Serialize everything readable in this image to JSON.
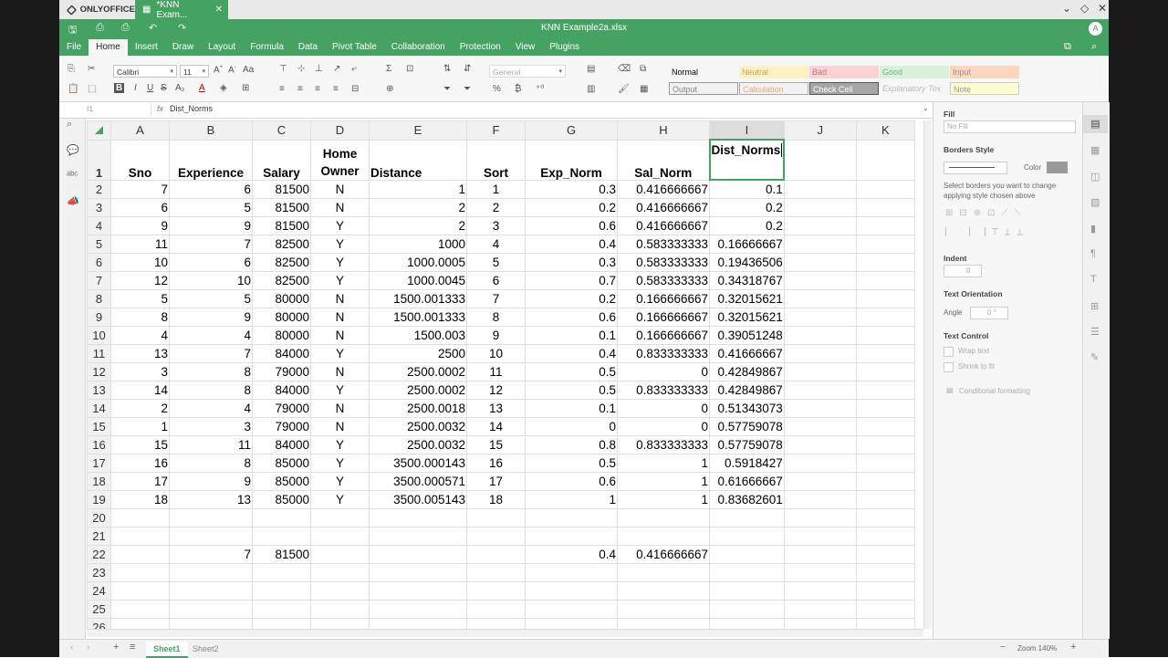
{
  "app": {
    "brand": "ONLYOFFICE",
    "tab_title": "*KNN Exam...",
    "doc_title": "KNN Example2a.xlsx",
    "user_initial": "A",
    "accent": "#44a363"
  },
  "menu": [
    "File",
    "Home",
    "Insert",
    "Draw",
    "Layout",
    "Formula",
    "Data",
    "Pivot Table",
    "Collaboration",
    "Protection",
    "View",
    "Plugins"
  ],
  "toolbar": {
    "font_name": "Calibri",
    "font_size": "11",
    "number_format": "General",
    "styles": [
      {
        "label": "Normal",
        "bg": "#ffffff",
        "color": "#555555"
      },
      {
        "label": "Neutral",
        "bg": "#fff1c4",
        "color": "#b98b2b"
      },
      {
        "label": "Bad",
        "bg": "#fbd3d7",
        "color": "#b0454d"
      },
      {
        "label": "Good",
        "bg": "#d9f1dc",
        "color": "#4a8e58"
      },
      {
        "label": "Input",
        "bg": "#fbd8bd",
        "color": "#7c6a5a"
      },
      {
        "label": "Output",
        "bg": "#f2f2f2",
        "color": "#555555"
      },
      {
        "label": "Calculation",
        "bg": "#f2f2f2",
        "color": "#e08a3c"
      },
      {
        "label": "Check Cell",
        "bg": "#a5a5a5",
        "color": "#ffffff"
      },
      {
        "label": "Explanatory Tex",
        "bg": "#ffffff",
        "color": "#888888"
      },
      {
        "label": "Note",
        "bg": "#fffdd0",
        "color": "#666666"
      }
    ]
  },
  "formula_bar": {
    "cell_ref": "I1",
    "fx": "fx",
    "content": "Dist_Norms"
  },
  "sheet": {
    "columns": [
      "A",
      "B",
      "C",
      "D",
      "E",
      "F",
      "G",
      "H",
      "I",
      "J",
      "K"
    ],
    "header": [
      "Sno",
      "Experience",
      "Salary",
      "Home\nOwner",
      "Distance",
      "Sort",
      "Exp_Norm",
      "Sal_Norm",
      "Dist_Norms",
      "",
      ""
    ],
    "rows": [
      [
        "2",
        "7",
        "6",
        "81500",
        "N",
        "1",
        "1",
        "0.3",
        "0.416666667",
        "0.1",
        "",
        ""
      ],
      [
        "3",
        "6",
        "5",
        "81500",
        "N",
        "2",
        "2",
        "0.2",
        "0.416666667",
        "0.2",
        "",
        ""
      ],
      [
        "4",
        "9",
        "9",
        "81500",
        "Y",
        "2",
        "3",
        "0.6",
        "0.416666667",
        "0.2",
        "",
        ""
      ],
      [
        "5",
        "11",
        "7",
        "82500",
        "Y",
        "1000",
        "4",
        "0.4",
        "0.583333333",
        "0.16666667",
        "",
        ""
      ],
      [
        "6",
        "10",
        "6",
        "82500",
        "Y",
        "1000.0005",
        "5",
        "0.3",
        "0.583333333",
        "0.19436506",
        "",
        ""
      ],
      [
        "7",
        "12",
        "10",
        "82500",
        "Y",
        "1000.0045",
        "6",
        "0.7",
        "0.583333333",
        "0.34318767",
        "",
        ""
      ],
      [
        "8",
        "5",
        "5",
        "80000",
        "N",
        "1500.001333",
        "7",
        "0.2",
        "0.166666667",
        "0.32015621",
        "",
        ""
      ],
      [
        "9",
        "8",
        "9",
        "80000",
        "N",
        "1500.001333",
        "8",
        "0.6",
        "0.166666667",
        "0.32015621",
        "",
        ""
      ],
      [
        "10",
        "4",
        "4",
        "80000",
        "N",
        "1500.003",
        "9",
        "0.1",
        "0.166666667",
        "0.39051248",
        "",
        ""
      ],
      [
        "11",
        "13",
        "7",
        "84000",
        "Y",
        "2500",
        "10",
        "0.4",
        "0.833333333",
        "0.41666667",
        "",
        ""
      ],
      [
        "12",
        "3",
        "8",
        "79000",
        "N",
        "2500.0002",
        "11",
        "0.5",
        "0",
        "0.42849867",
        "",
        ""
      ],
      [
        "13",
        "14",
        "8",
        "84000",
        "Y",
        "2500.0002",
        "12",
        "0.5",
        "0.833333333",
        "0.42849867",
        "",
        ""
      ],
      [
        "14",
        "2",
        "4",
        "79000",
        "N",
        "2500.0018",
        "13",
        "0.1",
        "0",
        "0.51343073",
        "",
        ""
      ],
      [
        "15",
        "1",
        "3",
        "79000",
        "N",
        "2500.0032",
        "14",
        "0",
        "0",
        "0.57759078",
        "",
        ""
      ],
      [
        "16",
        "15",
        "11",
        "84000",
        "Y",
        "2500.0032",
        "15",
        "0.8",
        "0.833333333",
        "0.57759078",
        "",
        ""
      ],
      [
        "17",
        "16",
        "8",
        "85000",
        "Y",
        "3500.000143",
        "16",
        "0.5",
        "1",
        "0.5918427",
        "",
        ""
      ],
      [
        "18",
        "17",
        "9",
        "85000",
        "Y",
        "3500.000571",
        "17",
        "0.6",
        "1",
        "0.61666667",
        "",
        ""
      ],
      [
        "19",
        "18",
        "13",
        "85000",
        "Y",
        "3500.005143",
        "18",
        "1",
        "1",
        "0.83682601",
        "",
        ""
      ],
      [
        "20",
        "",
        "",
        "",
        "",
        "",
        "",
        "",
        "",
        "",
        "",
        ""
      ],
      [
        "21",
        "",
        "",
        "",
        "",
        "",
        "",
        "",
        "",
        "",
        "",
        ""
      ],
      [
        "22",
        "",
        "7",
        "81500",
        "",
        "",
        "",
        "0.4",
        "0.416666667",
        "",
        "",
        ""
      ],
      [
        "23",
        "",
        "",
        "",
        "",
        "",
        "",
        "",
        "",
        "",
        "",
        ""
      ],
      [
        "24",
        "",
        "",
        "",
        "",
        "",
        "",
        "",
        "",
        "",
        "",
        ""
      ],
      [
        "25",
        "",
        "",
        "",
        "",
        "",
        "",
        "",
        "",
        "",
        "",
        ""
      ],
      [
        "26",
        "",
        "",
        "",
        "",
        "",
        "",
        "",
        "",
        "",
        "",
        ""
      ]
    ]
  },
  "sheet_tabs": [
    "Sheet1",
    "Sheet2"
  ],
  "zoom_label": "Zoom 140%",
  "right_panel": {
    "fill_title": "Fill",
    "fill_value": "No Fill",
    "borders_title": "Borders Style",
    "color_label": "Color",
    "border_color": "#9a9a9a",
    "borders_hint": "Select borders you want to change applying style chosen above",
    "indent_title": "Indent",
    "indent_value": "0",
    "orientation_title": "Text Orientation",
    "angle_label": "Angle",
    "angle_value": "0 °",
    "text_control_title": "Text Control",
    "wrap_label": "Wrap text",
    "shrink_label": "Shrink to fit",
    "conditional_label": "Conditional formatting"
  }
}
